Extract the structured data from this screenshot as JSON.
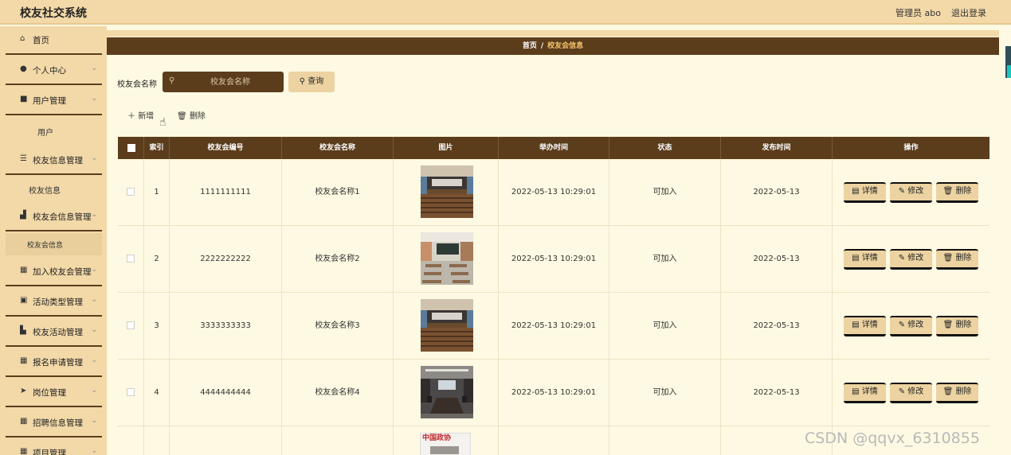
{
  "app": {
    "title": "校友社交系统",
    "user_label": "管理员 abo",
    "logout_label": "退出登录"
  },
  "sidebar": {
    "items": [
      {
        "label": "首页",
        "icon": "home-icon",
        "has_arrow": false
      },
      {
        "label": "个人中心",
        "icon": "user-icon",
        "has_arrow": true
      },
      {
        "label": "用户管理",
        "icon": "users-icon",
        "has_arrow": true
      },
      {
        "label": "用户",
        "sub": true
      },
      {
        "label": "校友信息管理",
        "icon": "sliders-icon",
        "has_arrow": true
      },
      {
        "label": "校友信息",
        "sub": true
      },
      {
        "label": "校友会信息管理",
        "icon": "building-icon",
        "has_arrow": true
      },
      {
        "label": "校友会信息",
        "sub": true,
        "active": true
      },
      {
        "label": "加入校友会管理",
        "icon": "grid-icon",
        "has_arrow": true
      },
      {
        "label": "活动类型管理",
        "icon": "clipboard-icon",
        "has_arrow": true
      },
      {
        "label": "校友活动管理",
        "icon": "thumbs-up-icon",
        "has_arrow": true
      },
      {
        "label": "报名申请管理",
        "icon": "grid-icon",
        "has_arrow": true
      },
      {
        "label": "岗位管理",
        "icon": "send-icon",
        "has_arrow": true
      },
      {
        "label": "招聘信息管理",
        "icon": "grid-icon",
        "has_arrow": true
      },
      {
        "label": "项目管理",
        "icon": "grid-icon",
        "has_arrow": true
      }
    ]
  },
  "breadcrumb": {
    "home": "首页",
    "separator": "/",
    "current": "校友会信息"
  },
  "search": {
    "label": "校友会名称",
    "placeholder": "校友会名称",
    "value": "",
    "query_button": "查询"
  },
  "actions": {
    "add_label": "新增",
    "delete_label": "删除"
  },
  "table": {
    "columns": [
      "",
      "索引",
      "校友会编号",
      "校友会名称",
      "图片",
      "举办时间",
      "状态",
      "发布时间",
      "操作"
    ],
    "rows": [
      {
        "index": "1",
        "code": "1111111111",
        "name": "校友会名称1",
        "image": "auditorium-photo",
        "held_time": "2022-05-13 10:29:01",
        "status": "可加入",
        "publish_time": "2022-05-13"
      },
      {
        "index": "2",
        "code": "2222222222",
        "name": "校友会名称2",
        "image": "classroom-photo",
        "held_time": "2022-05-13 10:29:01",
        "status": "可加入",
        "publish_time": "2022-05-13"
      },
      {
        "index": "3",
        "code": "3333333333",
        "name": "校友会名称3",
        "image": "auditorium-photo",
        "held_time": "2022-05-13 10:29:01",
        "status": "可加入",
        "publish_time": "2022-05-13"
      },
      {
        "index": "4",
        "code": "4444444444",
        "name": "校友会名称4",
        "image": "meeting-room-photo",
        "held_time": "2022-05-13 10:29:01",
        "status": "可加入",
        "publish_time": "2022-05-13"
      }
    ],
    "partial_row_image_text": "中国政协",
    "row_actions": {
      "detail": "详情",
      "edit": "修改",
      "delete": "删除"
    }
  },
  "watermark": "CSDN @qqvx_6310855",
  "colors": {
    "header_bg": "#f3d9a8",
    "dark_brown": "#5b3d1c",
    "content_bg": "#fdf9e2",
    "button_bg": "#ecd3a1",
    "accent_gold": "#f4c46a"
  }
}
